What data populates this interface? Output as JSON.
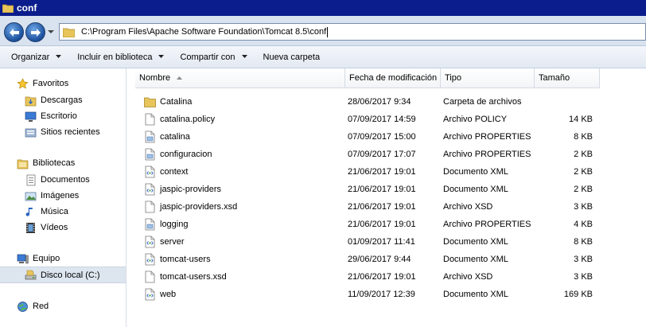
{
  "window": {
    "title": "conf"
  },
  "address": {
    "path": "C:\\Program Files\\Apache Software Foundation\\Tomcat 8.5\\conf"
  },
  "toolbar": {
    "organize": "Organizar",
    "include_library": "Incluir en biblioteca",
    "share_with": "Compartir con",
    "new_folder": "Nueva carpeta"
  },
  "sidebar": {
    "favorites": "Favoritos",
    "downloads": "Descargas",
    "desktop": "Escritorio",
    "recent": "Sitios recientes",
    "libraries": "Bibliotecas",
    "documents": "Documentos",
    "pictures": "Imágenes",
    "music": "Música",
    "videos": "Vídeos",
    "computer": "Equipo",
    "local_disk": "Disco local (C:)",
    "network": "Red"
  },
  "columns": {
    "name": "Nombre",
    "date": "Fecha de modificación",
    "type": "Tipo",
    "size": "Tamaño"
  },
  "files": [
    {
      "name": "Catalina",
      "date": "28/06/2017 9:34",
      "type": "Carpeta de archivos",
      "size": "",
      "icon": "folder-icon"
    },
    {
      "name": "catalina.policy",
      "date": "07/09/2017 14:59",
      "type": "Archivo POLICY",
      "size": "14 KB",
      "icon": "file-icon"
    },
    {
      "name": "catalina",
      "date": "07/09/2017 15:00",
      "type": "Archivo PROPERTIES",
      "size": "8 KB",
      "icon": "properties-icon"
    },
    {
      "name": "configuracion",
      "date": "07/09/2017 17:07",
      "type": "Archivo PROPERTIES",
      "size": "2 KB",
      "icon": "properties-icon"
    },
    {
      "name": "context",
      "date": "21/06/2017 19:01",
      "type": "Documento XML",
      "size": "2 KB",
      "icon": "xml-icon"
    },
    {
      "name": "jaspic-providers",
      "date": "21/06/2017 19:01",
      "type": "Documento XML",
      "size": "2 KB",
      "icon": "xml-icon"
    },
    {
      "name": "jaspic-providers.xsd",
      "date": "21/06/2017 19:01",
      "type": "Archivo XSD",
      "size": "3 KB",
      "icon": "file-icon"
    },
    {
      "name": "logging",
      "date": "21/06/2017 19:01",
      "type": "Archivo PROPERTIES",
      "size": "4 KB",
      "icon": "properties-icon"
    },
    {
      "name": "server",
      "date": "01/09/2017 11:41",
      "type": "Documento XML",
      "size": "8 KB",
      "icon": "xml-icon"
    },
    {
      "name": "tomcat-users",
      "date": "29/06/2017 9:44",
      "type": "Documento XML",
      "size": "3 KB",
      "icon": "xml-icon"
    },
    {
      "name": "tomcat-users.xsd",
      "date": "21/06/2017 19:01",
      "type": "Archivo XSD",
      "size": "3 KB",
      "icon": "file-icon"
    },
    {
      "name": "web",
      "date": "11/09/2017 12:39",
      "type": "Documento XML",
      "size": "169 KB",
      "icon": "xml-icon"
    }
  ]
}
